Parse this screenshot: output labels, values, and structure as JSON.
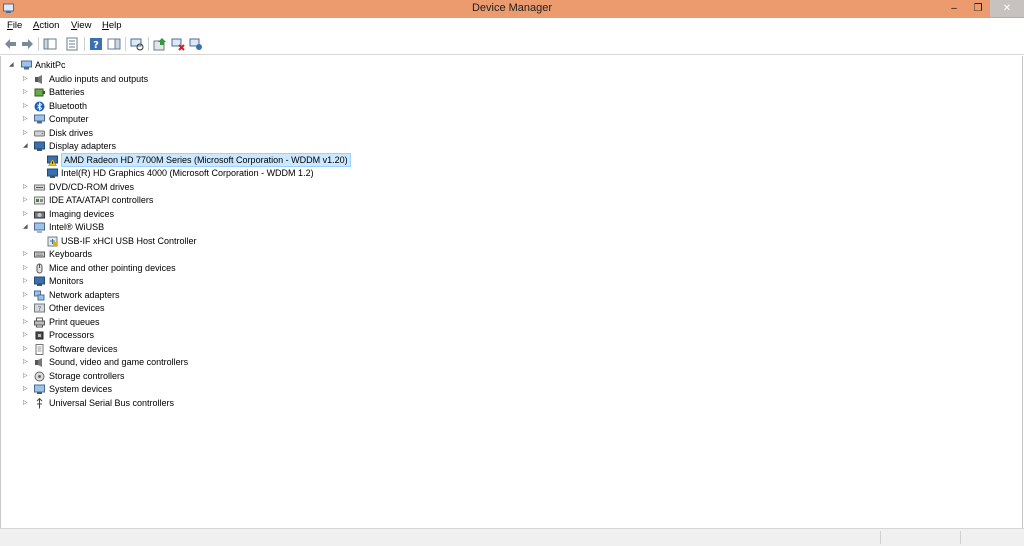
{
  "window": {
    "title": "Device Manager",
    "minimize_glyph": "–",
    "maximize_glyph": "❐",
    "close_glyph": "✕"
  },
  "menu": {
    "file": {
      "accel": "F",
      "rest": "ile"
    },
    "action": {
      "accel": "A",
      "rest": "ction"
    },
    "view": {
      "accel": "V",
      "rest": "iew"
    },
    "help": {
      "accel": "H",
      "rest": "elp"
    }
  },
  "toolbar": {
    "icons": [
      "back-arrow-icon",
      "forward-arrow-icon",
      "show-hide-console-tree-icon",
      "properties-icon",
      "help-icon",
      "action-pane-icon",
      "scan-hardware-icon",
      "update-driver-icon",
      "disable-device-icon",
      "uninstall-device-icon"
    ]
  },
  "tree": {
    "root": "AnkitPc",
    "items": [
      {
        "label": "Audio inputs and outputs",
        "icon": "speaker-icon",
        "expanded": false
      },
      {
        "label": "Batteries",
        "icon": "battery-icon",
        "expanded": false
      },
      {
        "label": "Bluetooth",
        "icon": "bluetooth-icon",
        "expanded": false
      },
      {
        "label": "Computer",
        "icon": "computer-icon",
        "expanded": false
      },
      {
        "label": "Disk drives",
        "icon": "disk-drive-icon",
        "expanded": false
      },
      {
        "label": "Display adapters",
        "icon": "monitor-icon",
        "expanded": true,
        "children": [
          {
            "label": "AMD Radeon HD 7700M Series (Microsoft Corporation - WDDM v1.20)",
            "icon": "warning-display-icon",
            "selected": true
          },
          {
            "label": "Intel(R) HD Graphics 4000 (Microsoft Corporation - WDDM 1.2)",
            "icon": "display-adapter-icon"
          }
        ]
      },
      {
        "label": "DVD/CD-ROM drives",
        "icon": "optical-drive-icon",
        "expanded": false
      },
      {
        "label": "IDE ATA/ATAPI controllers",
        "icon": "ide-controller-icon",
        "expanded": false
      },
      {
        "label": "Imaging devices",
        "icon": "camera-icon",
        "expanded": false
      },
      {
        "label": "Intel® WiUSB",
        "icon": "usb-hub-icon",
        "expanded": true,
        "children": [
          {
            "label": "USB-IF xHCI USB Host Controller",
            "icon": "usb-controller-icon"
          }
        ]
      },
      {
        "label": "Keyboards",
        "icon": "keyboard-icon",
        "expanded": false
      },
      {
        "label": "Mice and other pointing devices",
        "icon": "mouse-icon",
        "expanded": false
      },
      {
        "label": "Monitors",
        "icon": "monitor-icon",
        "expanded": false
      },
      {
        "label": "Network adapters",
        "icon": "network-icon",
        "expanded": false
      },
      {
        "label": "Other devices",
        "icon": "unknown-device-icon",
        "expanded": false
      },
      {
        "label": "Print queues",
        "icon": "printer-icon",
        "expanded": false
      },
      {
        "label": "Processors",
        "icon": "cpu-icon",
        "expanded": false
      },
      {
        "label": "Software devices",
        "icon": "software-device-icon",
        "expanded": false
      },
      {
        "label": "Sound, video and game controllers",
        "icon": "speaker-icon",
        "expanded": false
      },
      {
        "label": "Storage controllers",
        "icon": "storage-controller-icon",
        "expanded": false
      },
      {
        "label": "System devices",
        "icon": "system-device-icon",
        "expanded": false
      },
      {
        "label": "Universal Serial Bus controllers",
        "icon": "usb-icon",
        "expanded": false
      }
    ]
  },
  "colors": {
    "titlebar": "#ec9b6f",
    "selection": "#cce8ff",
    "selection_border": "#99d1ff"
  }
}
